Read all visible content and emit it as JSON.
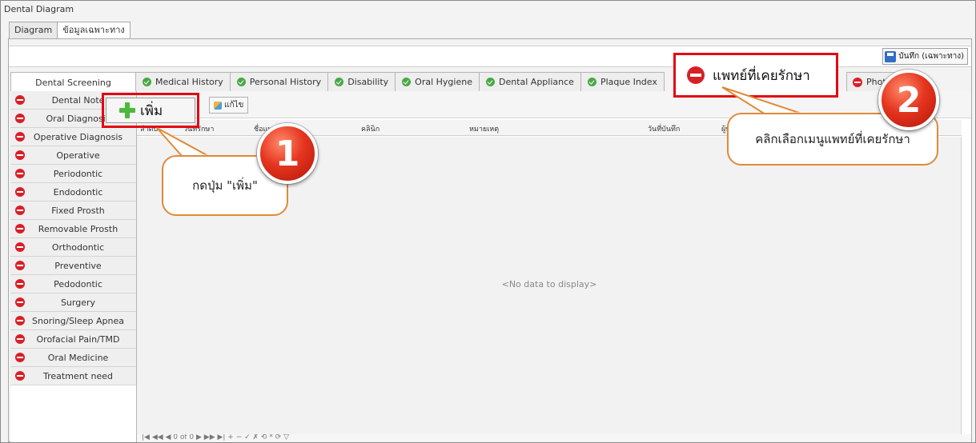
{
  "window": {
    "title": "Dental Diagram"
  },
  "top_tabs": [
    {
      "label": "Diagram"
    },
    {
      "label": "ข้อมูลเฉพาะทาง"
    }
  ],
  "save_button": {
    "label": "บันทึก (เฉพาะทาง)",
    "icon": "save-icon"
  },
  "section_tabs": [
    {
      "label": "Dental Screening",
      "status": "none"
    },
    {
      "label": "Medical History",
      "status": "ok"
    },
    {
      "label": "Personal History",
      "status": "ok"
    },
    {
      "label": "Disability",
      "status": "ok"
    },
    {
      "label": "Oral Hygiene",
      "status": "ok"
    },
    {
      "label": "Dental Appliance",
      "status": "ok"
    },
    {
      "label": "Plaque Index",
      "status": "ok"
    }
  ],
  "photo_tab": {
    "label": "Photo"
  },
  "sidebar": {
    "items": [
      {
        "label": "Dental Note"
      },
      {
        "label": "Oral Diagnosis"
      },
      {
        "label": "Operative Diagnosis"
      },
      {
        "label": "Operative"
      },
      {
        "label": "Periodontic"
      },
      {
        "label": "Endodontic"
      },
      {
        "label": "Fixed Prosth"
      },
      {
        "label": "Removable Prosth"
      },
      {
        "label": "Orthodontic"
      },
      {
        "label": "Preventive"
      },
      {
        "label": "Pedodontic"
      },
      {
        "label": "Surgery"
      },
      {
        "label": "Snoring/Sleep Apnea"
      },
      {
        "label": "Orofacial Pain/TMD"
      },
      {
        "label": "Oral Medicine"
      },
      {
        "label": "Treatment need"
      }
    ]
  },
  "toolbar": {
    "add_label": "เพิ่ม",
    "edit_label": "แก้ไข"
  },
  "grid": {
    "columns": [
      "ลำดับ",
      "วันที่รักษา",
      "ชื่อแพทย์",
      "คลินิก",
      "หมายเหตุ",
      "วันที่บันทึก",
      "ผู้บันทึก"
    ],
    "empty_text": "<No data to display>",
    "pager_text": "|◀ ◀◀ ◀ 0 of 0 ▶ ▶▶ ▶| + − ✓ ✗ ⟲ * ⟳ ▽"
  },
  "callouts": {
    "doctor_tab_label": "แพทย์ที่เคยรักษา",
    "step1_text": "กดปุ่ม \"เพิ่ม\"",
    "step2_text": "คลิกเลือกเมนูแพทย์ที่เคยรักษา",
    "step1_number": "1",
    "step2_number": "2"
  },
  "colors": {
    "error": "#d91f26",
    "ok": "#4ba845",
    "highlight": "#e30613",
    "bubble_border": "#e08a3a"
  }
}
